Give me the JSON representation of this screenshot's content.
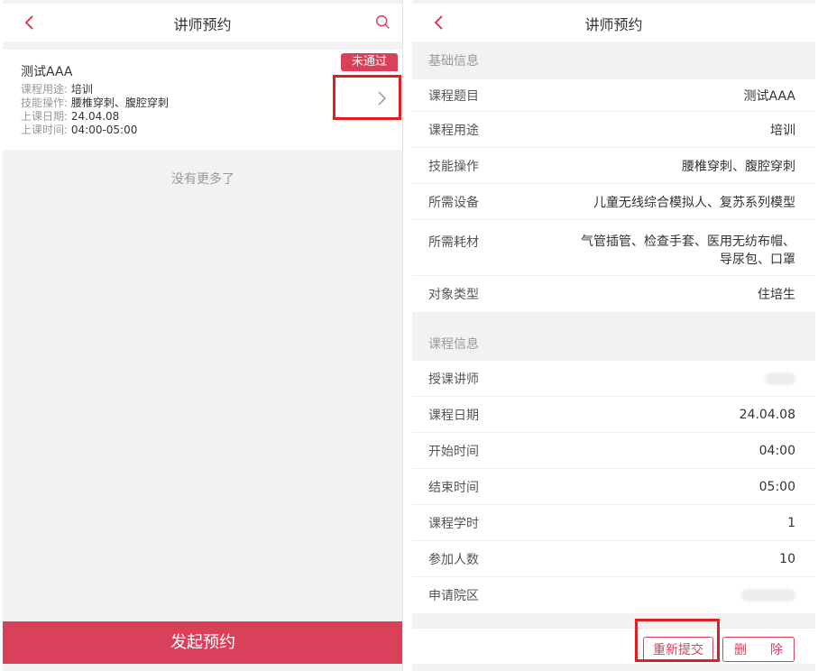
{
  "left": {
    "header": {
      "title": "讲师预约"
    },
    "card": {
      "title": "测试AAA",
      "status": "未通过",
      "rows": [
        {
          "label": "课程用途:",
          "value": "培训"
        },
        {
          "label": "技能操作:",
          "value": "腰椎穿刺、腹腔穿刺"
        },
        {
          "label": "上课日期:",
          "value": "24.04.08"
        },
        {
          "label": "上课时间:",
          "value": "04:00-05:00"
        }
      ]
    },
    "no_more": "没有更多了",
    "footer_button": "发起预约"
  },
  "right": {
    "header": {
      "title": "讲师预约"
    },
    "basic_section": "基础信息",
    "basic_rows": [
      {
        "label": "课程题目",
        "value": "测试AAA"
      },
      {
        "label": "课程用途",
        "value": "培训"
      },
      {
        "label": "技能操作",
        "value": "腰椎穿刺、腹腔穿刺"
      },
      {
        "label": "所需设备",
        "value": "儿童无线综合模拟人、复苏系列模型"
      },
      {
        "label": "所需耗材",
        "value_line1": "气管插管、检查手套、医用无纺布帽、",
        "value_line2": "导尿包、口罩"
      },
      {
        "label": "对象类型",
        "value": "住培生"
      }
    ],
    "course_section": "课程信息",
    "course_rows": [
      {
        "label": "授课讲师"
      },
      {
        "label": "课程日期",
        "value": "24.04.08"
      },
      {
        "label": "开始时间",
        "value": "04:00"
      },
      {
        "label": "结束时间",
        "value": "05:00"
      },
      {
        "label": "课程学时",
        "value": "1"
      },
      {
        "label": "参加人数",
        "value": "10"
      },
      {
        "label": "申请院区"
      }
    ],
    "buttons": {
      "resubmit": "重新提交",
      "delete_1": "删",
      "delete_2": "除"
    }
  },
  "colors": {
    "accent": "#d9405a",
    "highlight": "#e02020"
  }
}
